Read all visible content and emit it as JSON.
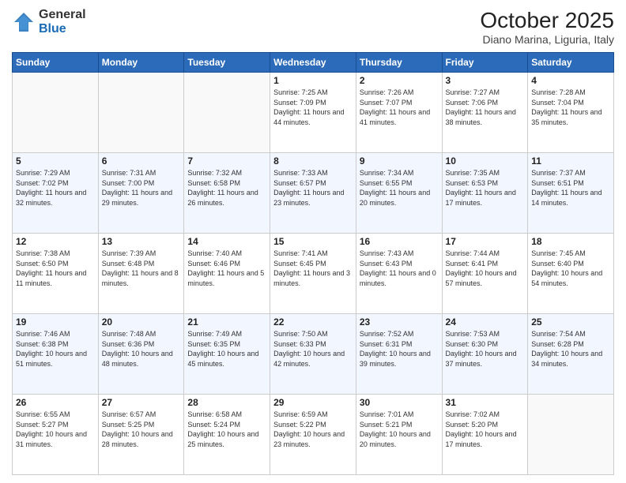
{
  "header": {
    "logo_line1": "General",
    "logo_line2": "Blue",
    "month": "October 2025",
    "location": "Diano Marina, Liguria, Italy"
  },
  "weekdays": [
    "Sunday",
    "Monday",
    "Tuesday",
    "Wednesday",
    "Thursday",
    "Friday",
    "Saturday"
  ],
  "weeks": [
    [
      {
        "day": "",
        "sunrise": "",
        "sunset": "",
        "daylight": ""
      },
      {
        "day": "",
        "sunrise": "",
        "sunset": "",
        "daylight": ""
      },
      {
        "day": "",
        "sunrise": "",
        "sunset": "",
        "daylight": ""
      },
      {
        "day": "1",
        "sunrise": "Sunrise: 7:25 AM",
        "sunset": "Sunset: 7:09 PM",
        "daylight": "Daylight: 11 hours and 44 minutes."
      },
      {
        "day": "2",
        "sunrise": "Sunrise: 7:26 AM",
        "sunset": "Sunset: 7:07 PM",
        "daylight": "Daylight: 11 hours and 41 minutes."
      },
      {
        "day": "3",
        "sunrise": "Sunrise: 7:27 AM",
        "sunset": "Sunset: 7:06 PM",
        "daylight": "Daylight: 11 hours and 38 minutes."
      },
      {
        "day": "4",
        "sunrise": "Sunrise: 7:28 AM",
        "sunset": "Sunset: 7:04 PM",
        "daylight": "Daylight: 11 hours and 35 minutes."
      }
    ],
    [
      {
        "day": "5",
        "sunrise": "Sunrise: 7:29 AM",
        "sunset": "Sunset: 7:02 PM",
        "daylight": "Daylight: 11 hours and 32 minutes."
      },
      {
        "day": "6",
        "sunrise": "Sunrise: 7:31 AM",
        "sunset": "Sunset: 7:00 PM",
        "daylight": "Daylight: 11 hours and 29 minutes."
      },
      {
        "day": "7",
        "sunrise": "Sunrise: 7:32 AM",
        "sunset": "Sunset: 6:58 PM",
        "daylight": "Daylight: 11 hours and 26 minutes."
      },
      {
        "day": "8",
        "sunrise": "Sunrise: 7:33 AM",
        "sunset": "Sunset: 6:57 PM",
        "daylight": "Daylight: 11 hours and 23 minutes."
      },
      {
        "day": "9",
        "sunrise": "Sunrise: 7:34 AM",
        "sunset": "Sunset: 6:55 PM",
        "daylight": "Daylight: 11 hours and 20 minutes."
      },
      {
        "day": "10",
        "sunrise": "Sunrise: 7:35 AM",
        "sunset": "Sunset: 6:53 PM",
        "daylight": "Daylight: 11 hours and 17 minutes."
      },
      {
        "day": "11",
        "sunrise": "Sunrise: 7:37 AM",
        "sunset": "Sunset: 6:51 PM",
        "daylight": "Daylight: 11 hours and 14 minutes."
      }
    ],
    [
      {
        "day": "12",
        "sunrise": "Sunrise: 7:38 AM",
        "sunset": "Sunset: 6:50 PM",
        "daylight": "Daylight: 11 hours and 11 minutes."
      },
      {
        "day": "13",
        "sunrise": "Sunrise: 7:39 AM",
        "sunset": "Sunset: 6:48 PM",
        "daylight": "Daylight: 11 hours and 8 minutes."
      },
      {
        "day": "14",
        "sunrise": "Sunrise: 7:40 AM",
        "sunset": "Sunset: 6:46 PM",
        "daylight": "Daylight: 11 hours and 5 minutes."
      },
      {
        "day": "15",
        "sunrise": "Sunrise: 7:41 AM",
        "sunset": "Sunset: 6:45 PM",
        "daylight": "Daylight: 11 hours and 3 minutes."
      },
      {
        "day": "16",
        "sunrise": "Sunrise: 7:43 AM",
        "sunset": "Sunset: 6:43 PM",
        "daylight": "Daylight: 11 hours and 0 minutes."
      },
      {
        "day": "17",
        "sunrise": "Sunrise: 7:44 AM",
        "sunset": "Sunset: 6:41 PM",
        "daylight": "Daylight: 10 hours and 57 minutes."
      },
      {
        "day": "18",
        "sunrise": "Sunrise: 7:45 AM",
        "sunset": "Sunset: 6:40 PM",
        "daylight": "Daylight: 10 hours and 54 minutes."
      }
    ],
    [
      {
        "day": "19",
        "sunrise": "Sunrise: 7:46 AM",
        "sunset": "Sunset: 6:38 PM",
        "daylight": "Daylight: 10 hours and 51 minutes."
      },
      {
        "day": "20",
        "sunrise": "Sunrise: 7:48 AM",
        "sunset": "Sunset: 6:36 PM",
        "daylight": "Daylight: 10 hours and 48 minutes."
      },
      {
        "day": "21",
        "sunrise": "Sunrise: 7:49 AM",
        "sunset": "Sunset: 6:35 PM",
        "daylight": "Daylight: 10 hours and 45 minutes."
      },
      {
        "day": "22",
        "sunrise": "Sunrise: 7:50 AM",
        "sunset": "Sunset: 6:33 PM",
        "daylight": "Daylight: 10 hours and 42 minutes."
      },
      {
        "day": "23",
        "sunrise": "Sunrise: 7:52 AM",
        "sunset": "Sunset: 6:31 PM",
        "daylight": "Daylight: 10 hours and 39 minutes."
      },
      {
        "day": "24",
        "sunrise": "Sunrise: 7:53 AM",
        "sunset": "Sunset: 6:30 PM",
        "daylight": "Daylight: 10 hours and 37 minutes."
      },
      {
        "day": "25",
        "sunrise": "Sunrise: 7:54 AM",
        "sunset": "Sunset: 6:28 PM",
        "daylight": "Daylight: 10 hours and 34 minutes."
      }
    ],
    [
      {
        "day": "26",
        "sunrise": "Sunrise: 6:55 AM",
        "sunset": "Sunset: 5:27 PM",
        "daylight": "Daylight: 10 hours and 31 minutes."
      },
      {
        "day": "27",
        "sunrise": "Sunrise: 6:57 AM",
        "sunset": "Sunset: 5:25 PM",
        "daylight": "Daylight: 10 hours and 28 minutes."
      },
      {
        "day": "28",
        "sunrise": "Sunrise: 6:58 AM",
        "sunset": "Sunset: 5:24 PM",
        "daylight": "Daylight: 10 hours and 25 minutes."
      },
      {
        "day": "29",
        "sunrise": "Sunrise: 6:59 AM",
        "sunset": "Sunset: 5:22 PM",
        "daylight": "Daylight: 10 hours and 23 minutes."
      },
      {
        "day": "30",
        "sunrise": "Sunrise: 7:01 AM",
        "sunset": "Sunset: 5:21 PM",
        "daylight": "Daylight: 10 hours and 20 minutes."
      },
      {
        "day": "31",
        "sunrise": "Sunrise: 7:02 AM",
        "sunset": "Sunset: 5:20 PM",
        "daylight": "Daylight: 10 hours and 17 minutes."
      },
      {
        "day": "",
        "sunrise": "",
        "sunset": "",
        "daylight": ""
      }
    ]
  ]
}
